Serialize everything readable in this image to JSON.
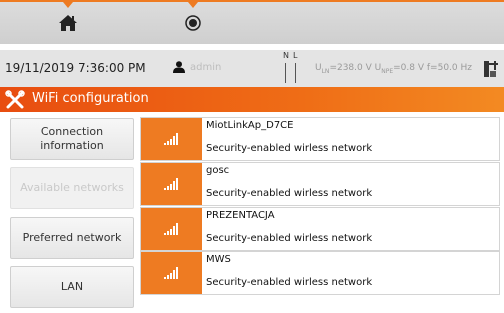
{
  "topbar": {
    "buttons": [
      {
        "icon": "home-icon"
      },
      {
        "icon": "record-icon"
      }
    ],
    "accent": "#ee7b22"
  },
  "status": {
    "datetime": "19/11/2019 7:36:00 PM",
    "user": "admin",
    "neutral_label": "N",
    "line_label": "L",
    "measurements": "Uₗₙ=238.0 V Uₙₚₑ=0.8 V f=50.0 Hz",
    "meas_uln_sym": "U",
    "meas_uln_sub": "LN",
    "meas_uln_val": "=238.0 V",
    "meas_unpe_sym": "U",
    "meas_unpe_sub": "NPE",
    "meas_unpe_val": "=0.8 V",
    "meas_f": "f=50.0 Hz"
  },
  "title": {
    "text": "WiFi configuration",
    "icon": "tools-icon",
    "color": "#ef6d16"
  },
  "side_menu": [
    {
      "label": "Connection information",
      "enabled": true
    },
    {
      "label": "Available networks",
      "enabled": false
    },
    {
      "label": "Preferred network",
      "enabled": true
    },
    {
      "label": "LAN",
      "enabled": true
    }
  ],
  "networks": [
    {
      "ssid": "MiotLinkAp_D7CE",
      "security": "Security-enabled wirless network"
    },
    {
      "ssid": "gosc",
      "security": "Security-enabled wirless network"
    },
    {
      "ssid": "PREZENTACJA",
      "security": "Security-enabled wirless network"
    },
    {
      "ssid": "MWS",
      "security": "Security-enabled wirless network"
    }
  ]
}
